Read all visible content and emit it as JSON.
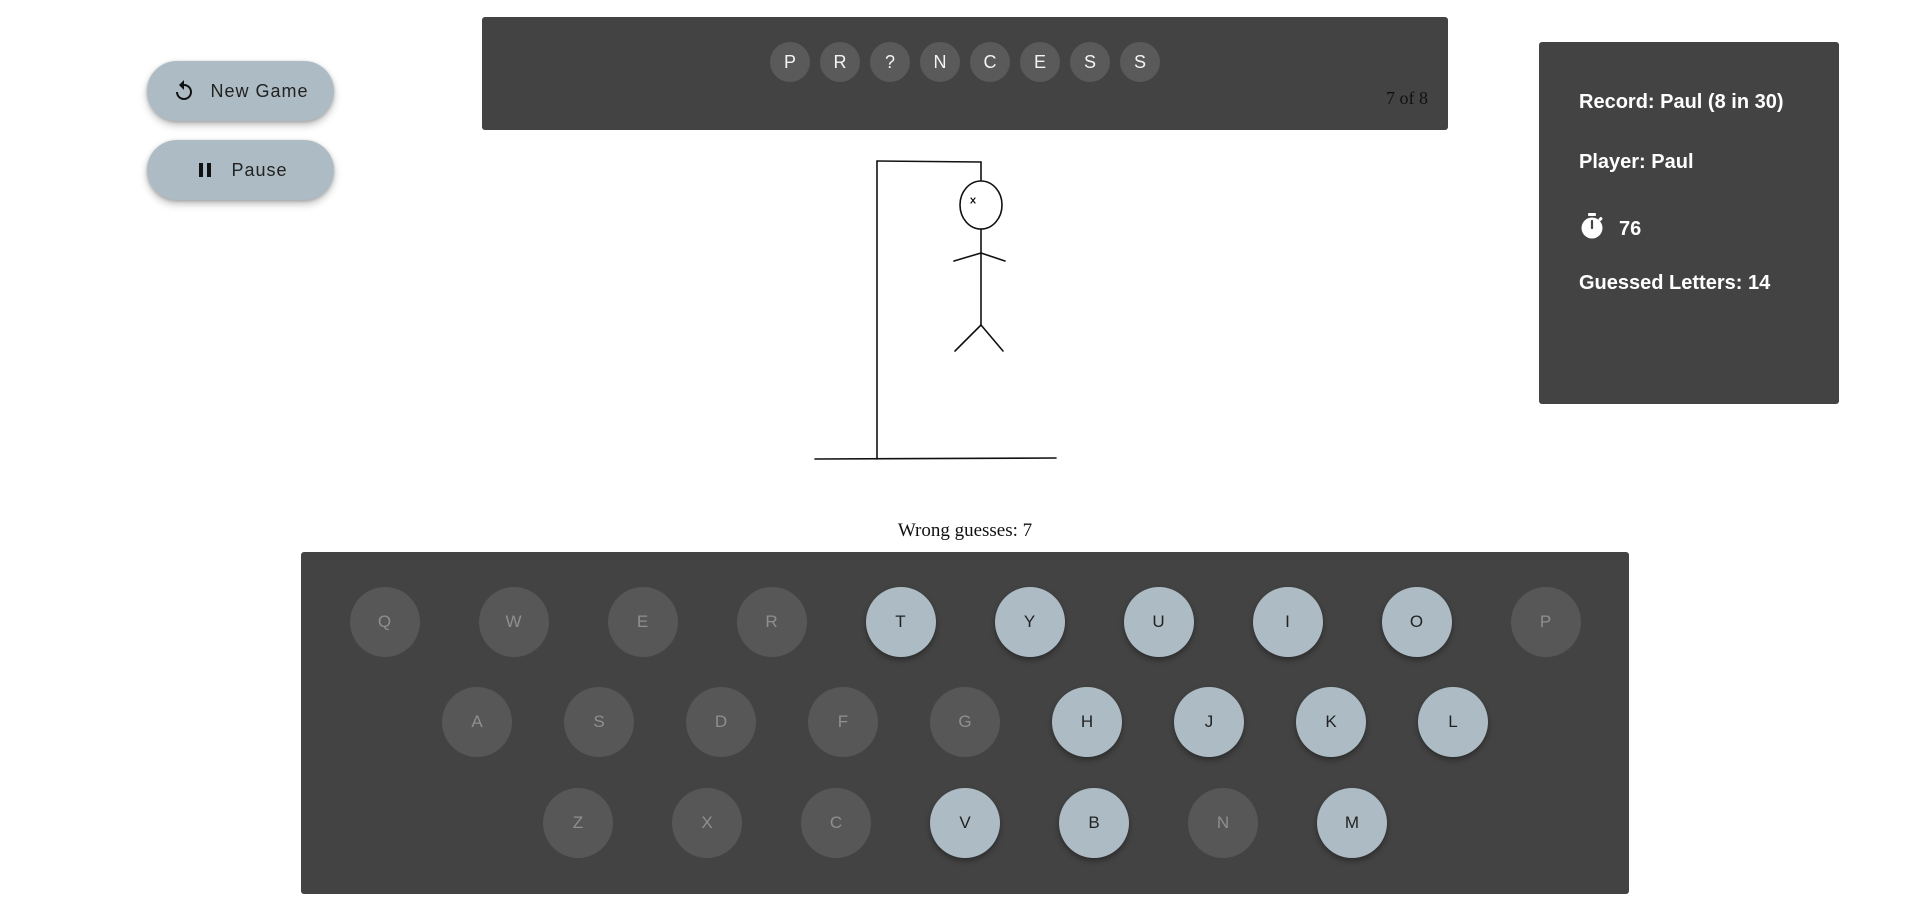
{
  "controls": {
    "new_game_label": "New Game",
    "pause_label": "Pause",
    "new_game_icon": "restart-icon",
    "pause_icon": "pause-icon",
    "button_color": "#adbcc4"
  },
  "word": {
    "letters": [
      "P",
      "R",
      "?",
      "N",
      "C",
      "E",
      "S",
      "S"
    ],
    "attempts_label": "7 of 8"
  },
  "hangman": {
    "parts_drawn": 7,
    "max_parts": 8
  },
  "wrong_guesses_label": "Wrong guesses: 7",
  "keyboard": {
    "rows": [
      [
        {
          "letter": "Q",
          "used": true
        },
        {
          "letter": "W",
          "used": true
        },
        {
          "letter": "E",
          "used": true
        },
        {
          "letter": "R",
          "used": true
        },
        {
          "letter": "T",
          "used": false
        },
        {
          "letter": "Y",
          "used": false
        },
        {
          "letter": "U",
          "used": false
        },
        {
          "letter": "I",
          "used": false
        },
        {
          "letter": "O",
          "used": false
        },
        {
          "letter": "P",
          "used": true
        }
      ],
      [
        {
          "letter": "A",
          "used": true
        },
        {
          "letter": "S",
          "used": true
        },
        {
          "letter": "D",
          "used": true
        },
        {
          "letter": "F",
          "used": true
        },
        {
          "letter": "G",
          "used": true
        },
        {
          "letter": "H",
          "used": false
        },
        {
          "letter": "J",
          "used": false
        },
        {
          "letter": "K",
          "used": false
        },
        {
          "letter": "L",
          "used": false
        }
      ],
      [
        {
          "letter": "Z",
          "used": true
        },
        {
          "letter": "X",
          "used": true
        },
        {
          "letter": "C",
          "used": true
        },
        {
          "letter": "V",
          "used": false
        },
        {
          "letter": "B",
          "used": false
        },
        {
          "letter": "N",
          "used": true
        },
        {
          "letter": "M",
          "used": false
        }
      ]
    ],
    "used_color": "#575757",
    "available_color": "#adbcc4"
  },
  "stats": {
    "record": "Record: Paul (8 in 30)",
    "player": "Player: Paul",
    "timer_icon": "stopwatch-icon",
    "timer": "76",
    "guessed": "Guessed Letters: 14"
  }
}
